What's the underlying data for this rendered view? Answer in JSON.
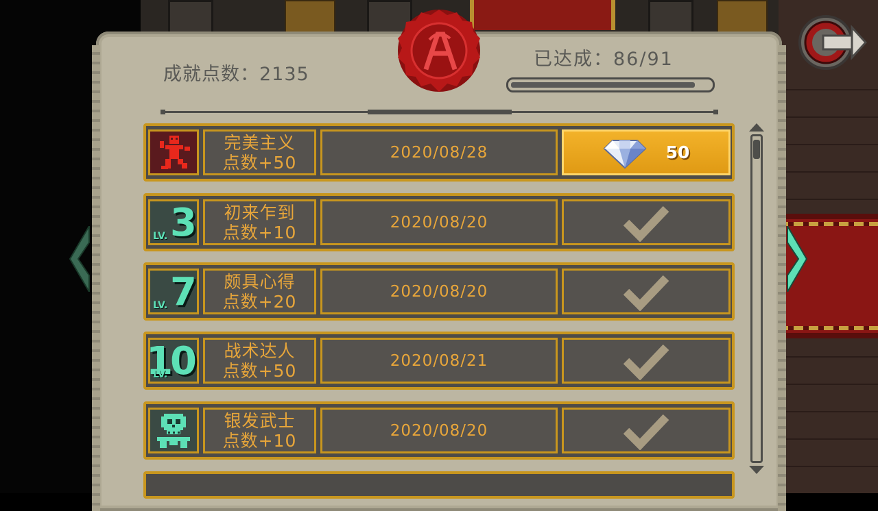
{
  "header": {
    "points_label": "成就点数：2135",
    "achieved_label": "已达成：86/91",
    "progress_fraction": 0.945
  },
  "achievements": [
    {
      "icon": "red-runner-icon",
      "name": "完美主义",
      "points": "点数+50",
      "date": "2020/08/28",
      "reward": {
        "state": "claimable",
        "icon": "diamond-icon",
        "amount": "50"
      }
    },
    {
      "icon": "level-badge-icon",
      "level": "3",
      "level_tag": "LV.",
      "name": "初来乍到",
      "points": "点数+10",
      "date": "2020/08/20",
      "reward": {
        "state": "claimed",
        "icon": "checkmark-icon"
      }
    },
    {
      "icon": "level-badge-icon",
      "level": "7",
      "level_tag": "LV.",
      "name": "颇具心得",
      "points": "点数+20",
      "date": "2020/08/20",
      "reward": {
        "state": "claimed",
        "icon": "checkmark-icon"
      }
    },
    {
      "icon": "level-badge-icon",
      "level": "10",
      "level_tag": "LV.",
      "name": "战术达人",
      "points": "点数+50",
      "date": "2020/08/21",
      "reward": {
        "state": "claimed",
        "icon": "checkmark-icon"
      }
    },
    {
      "icon": "skull-warrior-icon",
      "name": "银发武士",
      "points": "点数+10",
      "date": "2020/08/20",
      "reward": {
        "state": "claimed",
        "icon": "checkmark-icon"
      }
    }
  ],
  "colors": {
    "gold": "#c8961e",
    "text_gold": "#e8a63a",
    "teal": "#5de0b6",
    "parchment": "#bcb6a2",
    "row_bg": "#4d4b48",
    "wax_red": "#b81818"
  }
}
